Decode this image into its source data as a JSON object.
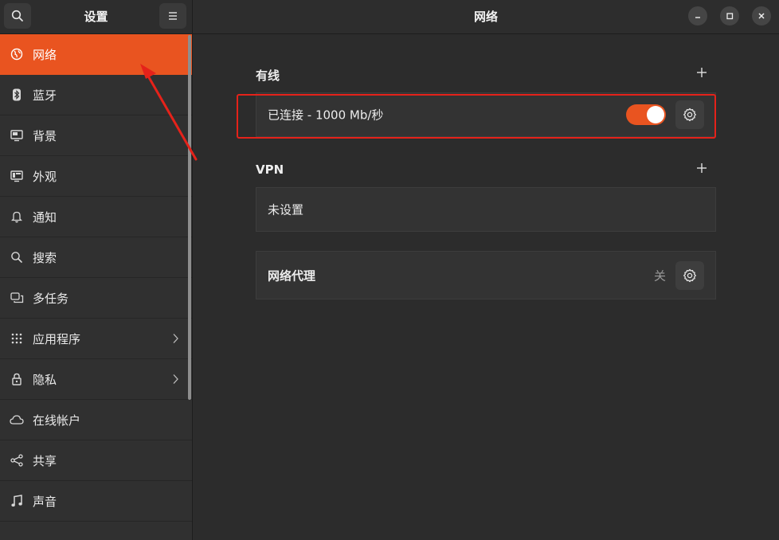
{
  "sidebar": {
    "title": "设置",
    "items": [
      {
        "label": "网络",
        "icon": "globe-icon",
        "active": true
      },
      {
        "label": "蓝牙",
        "icon": "bluetooth-icon"
      },
      {
        "label": "背景",
        "icon": "monitor-icon"
      },
      {
        "label": "外观",
        "icon": "appearance-icon"
      },
      {
        "label": "通知",
        "icon": "bell-icon"
      },
      {
        "label": "搜索",
        "icon": "search-icon"
      },
      {
        "label": "多任务",
        "icon": "multitask-icon"
      },
      {
        "label": "应用程序",
        "icon": "apps-grid-icon",
        "has_submenu": true
      },
      {
        "label": "隐私",
        "icon": "lock-icon",
        "has_submenu": true
      },
      {
        "label": "在线帐户",
        "icon": "cloud-icon"
      },
      {
        "label": "共享",
        "icon": "share-icon"
      },
      {
        "label": "声音",
        "icon": "music-note-icon"
      }
    ]
  },
  "main": {
    "title": "网络",
    "wired": {
      "title": "有线",
      "connection_label": "已连接 - 1000 Mb/秒",
      "enabled": true
    },
    "vpn": {
      "title": "VPN",
      "status_label": "未设置"
    },
    "proxy": {
      "title": "网络代理",
      "status": "关"
    }
  },
  "colors": {
    "accent": "#e95420",
    "annotation": "#e5221a",
    "background": "#2c2c2c",
    "sidebar_background": "#303030"
  }
}
